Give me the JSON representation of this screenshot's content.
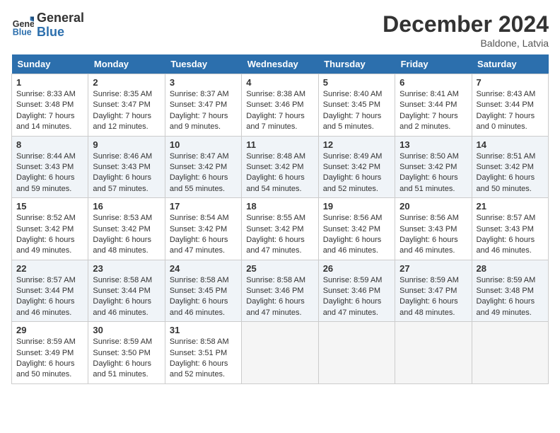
{
  "header": {
    "logo_line1": "General",
    "logo_line2": "Blue",
    "month": "December 2024",
    "location": "Baldone, Latvia"
  },
  "days_of_week": [
    "Sunday",
    "Monday",
    "Tuesday",
    "Wednesday",
    "Thursday",
    "Friday",
    "Saturday"
  ],
  "weeks": [
    [
      {
        "day": 1,
        "sunrise": "Sunrise: 8:33 AM",
        "sunset": "Sunset: 3:48 PM",
        "daylight": "Daylight: 7 hours and 14 minutes."
      },
      {
        "day": 2,
        "sunrise": "Sunrise: 8:35 AM",
        "sunset": "Sunset: 3:47 PM",
        "daylight": "Daylight: 7 hours and 12 minutes."
      },
      {
        "day": 3,
        "sunrise": "Sunrise: 8:37 AM",
        "sunset": "Sunset: 3:47 PM",
        "daylight": "Daylight: 7 hours and 9 minutes."
      },
      {
        "day": 4,
        "sunrise": "Sunrise: 8:38 AM",
        "sunset": "Sunset: 3:46 PM",
        "daylight": "Daylight: 7 hours and 7 minutes."
      },
      {
        "day": 5,
        "sunrise": "Sunrise: 8:40 AM",
        "sunset": "Sunset: 3:45 PM",
        "daylight": "Daylight: 7 hours and 5 minutes."
      },
      {
        "day": 6,
        "sunrise": "Sunrise: 8:41 AM",
        "sunset": "Sunset: 3:44 PM",
        "daylight": "Daylight: 7 hours and 2 minutes."
      },
      {
        "day": 7,
        "sunrise": "Sunrise: 8:43 AM",
        "sunset": "Sunset: 3:44 PM",
        "daylight": "Daylight: 7 hours and 0 minutes."
      }
    ],
    [
      {
        "day": 8,
        "sunrise": "Sunrise: 8:44 AM",
        "sunset": "Sunset: 3:43 PM",
        "daylight": "Daylight: 6 hours and 59 minutes."
      },
      {
        "day": 9,
        "sunrise": "Sunrise: 8:46 AM",
        "sunset": "Sunset: 3:43 PM",
        "daylight": "Daylight: 6 hours and 57 minutes."
      },
      {
        "day": 10,
        "sunrise": "Sunrise: 8:47 AM",
        "sunset": "Sunset: 3:42 PM",
        "daylight": "Daylight: 6 hours and 55 minutes."
      },
      {
        "day": 11,
        "sunrise": "Sunrise: 8:48 AM",
        "sunset": "Sunset: 3:42 PM",
        "daylight": "Daylight: 6 hours and 54 minutes."
      },
      {
        "day": 12,
        "sunrise": "Sunrise: 8:49 AM",
        "sunset": "Sunset: 3:42 PM",
        "daylight": "Daylight: 6 hours and 52 minutes."
      },
      {
        "day": 13,
        "sunrise": "Sunrise: 8:50 AM",
        "sunset": "Sunset: 3:42 PM",
        "daylight": "Daylight: 6 hours and 51 minutes."
      },
      {
        "day": 14,
        "sunrise": "Sunrise: 8:51 AM",
        "sunset": "Sunset: 3:42 PM",
        "daylight": "Daylight: 6 hours and 50 minutes."
      }
    ],
    [
      {
        "day": 15,
        "sunrise": "Sunrise: 8:52 AM",
        "sunset": "Sunset: 3:42 PM",
        "daylight": "Daylight: 6 hours and 49 minutes."
      },
      {
        "day": 16,
        "sunrise": "Sunrise: 8:53 AM",
        "sunset": "Sunset: 3:42 PM",
        "daylight": "Daylight: 6 hours and 48 minutes."
      },
      {
        "day": 17,
        "sunrise": "Sunrise: 8:54 AM",
        "sunset": "Sunset: 3:42 PM",
        "daylight": "Daylight: 6 hours and 47 minutes."
      },
      {
        "day": 18,
        "sunrise": "Sunrise: 8:55 AM",
        "sunset": "Sunset: 3:42 PM",
        "daylight": "Daylight: 6 hours and 47 minutes."
      },
      {
        "day": 19,
        "sunrise": "Sunrise: 8:56 AM",
        "sunset": "Sunset: 3:42 PM",
        "daylight": "Daylight: 6 hours and 46 minutes."
      },
      {
        "day": 20,
        "sunrise": "Sunrise: 8:56 AM",
        "sunset": "Sunset: 3:43 PM",
        "daylight": "Daylight: 6 hours and 46 minutes."
      },
      {
        "day": 21,
        "sunrise": "Sunrise: 8:57 AM",
        "sunset": "Sunset: 3:43 PM",
        "daylight": "Daylight: 6 hours and 46 minutes."
      }
    ],
    [
      {
        "day": 22,
        "sunrise": "Sunrise: 8:57 AM",
        "sunset": "Sunset: 3:44 PM",
        "daylight": "Daylight: 6 hours and 46 minutes."
      },
      {
        "day": 23,
        "sunrise": "Sunrise: 8:58 AM",
        "sunset": "Sunset: 3:44 PM",
        "daylight": "Daylight: 6 hours and 46 minutes."
      },
      {
        "day": 24,
        "sunrise": "Sunrise: 8:58 AM",
        "sunset": "Sunset: 3:45 PM",
        "daylight": "Daylight: 6 hours and 46 minutes."
      },
      {
        "day": 25,
        "sunrise": "Sunrise: 8:58 AM",
        "sunset": "Sunset: 3:46 PM",
        "daylight": "Daylight: 6 hours and 47 minutes."
      },
      {
        "day": 26,
        "sunrise": "Sunrise: 8:59 AM",
        "sunset": "Sunset: 3:46 PM",
        "daylight": "Daylight: 6 hours and 47 minutes."
      },
      {
        "day": 27,
        "sunrise": "Sunrise: 8:59 AM",
        "sunset": "Sunset: 3:47 PM",
        "daylight": "Daylight: 6 hours and 48 minutes."
      },
      {
        "day": 28,
        "sunrise": "Sunrise: 8:59 AM",
        "sunset": "Sunset: 3:48 PM",
        "daylight": "Daylight: 6 hours and 49 minutes."
      }
    ],
    [
      {
        "day": 29,
        "sunrise": "Sunrise: 8:59 AM",
        "sunset": "Sunset: 3:49 PM",
        "daylight": "Daylight: 6 hours and 50 minutes."
      },
      {
        "day": 30,
        "sunrise": "Sunrise: 8:59 AM",
        "sunset": "Sunset: 3:50 PM",
        "daylight": "Daylight: 6 hours and 51 minutes."
      },
      {
        "day": 31,
        "sunrise": "Sunrise: 8:58 AM",
        "sunset": "Sunset: 3:51 PM",
        "daylight": "Daylight: 6 hours and 52 minutes."
      },
      null,
      null,
      null,
      null
    ]
  ]
}
